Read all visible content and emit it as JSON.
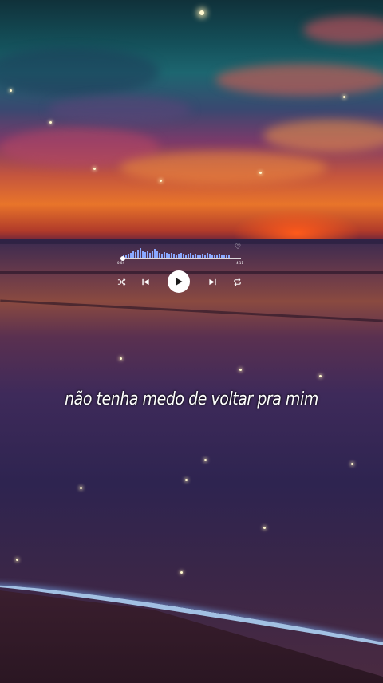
{
  "player": {
    "elapsed": "0:04",
    "duration": "-4:11",
    "progress": 0.02,
    "accent_color": "#8aa8ff",
    "icons": [
      "heart-icon",
      "shuffle-icon",
      "previous-icon",
      "play-icon",
      "next-icon",
      "repeat-icon"
    ]
  },
  "lyrics": {
    "line": "não tenha medo de voltar pra mim"
  }
}
